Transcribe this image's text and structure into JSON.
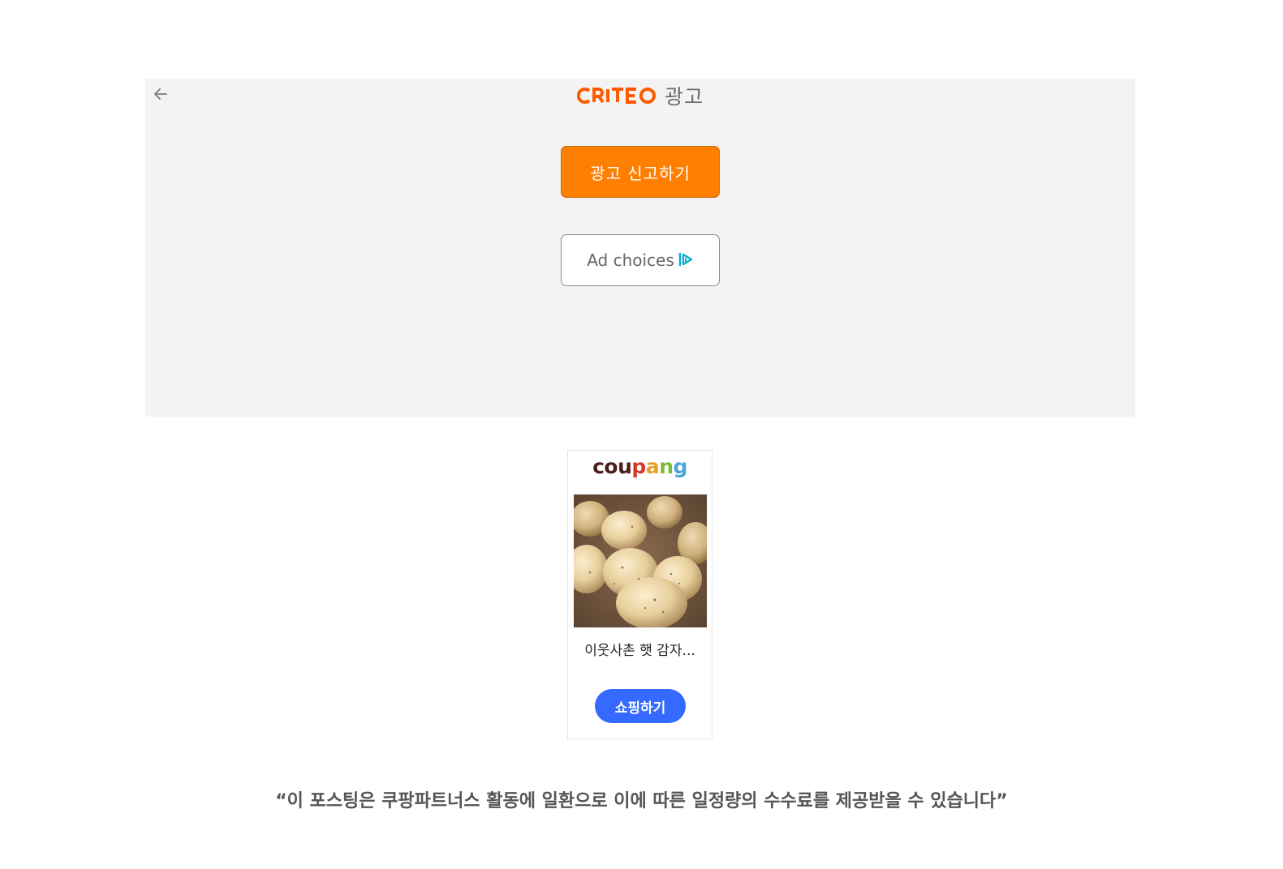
{
  "criteo_panel": {
    "brand": "CRITEO",
    "header_label": "광고",
    "report_button_label": "광고 신고하기",
    "adchoices_label": "Ad choices",
    "colors": {
      "brand": "#ff5a00",
      "report_button": "#ff7f00",
      "adchoices_icon": "#00aecd"
    },
    "icons": {
      "back": "back-arrow-icon",
      "adchoices": "adchoices-icon"
    }
  },
  "coupang_card": {
    "brand": "coupang",
    "product_title": "이웃사촌 햇 감자...",
    "shop_button_label": "쇼핑하기",
    "colors": {
      "shop_button": "#346aff"
    }
  },
  "disclaimer": "“이 포스팅은 쿠팡파트너스 활동에 일환으로 이에 따른 일정량의 수수료를 제공받을 수 있습니다”"
}
